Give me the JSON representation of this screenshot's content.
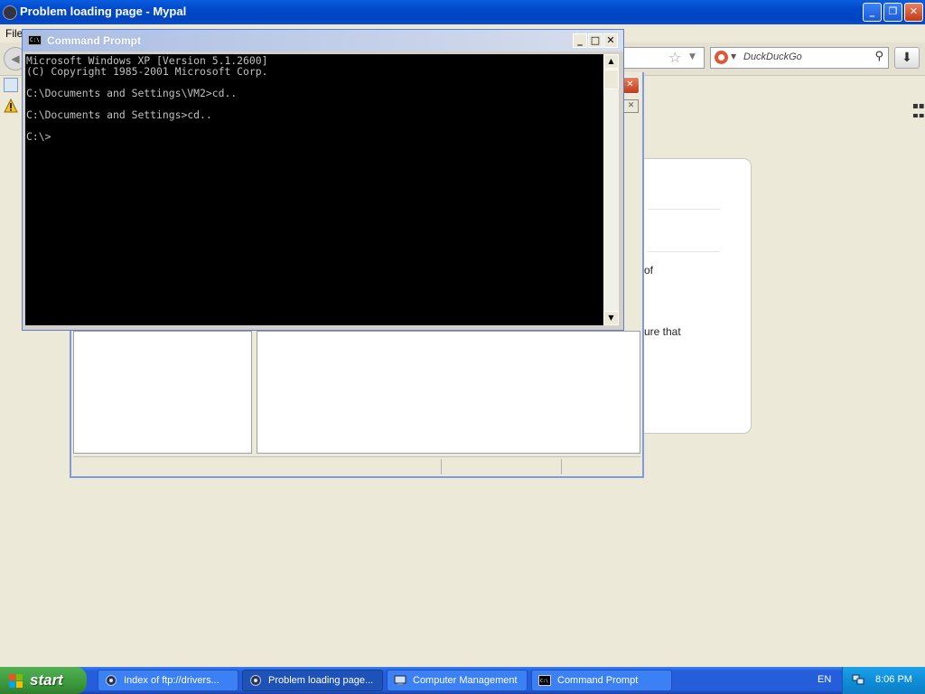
{
  "browser": {
    "title": "Problem loading page - Mypal",
    "menu_first": "File",
    "search_placeholder": "DuckDuckGo",
    "partial_text_1": "of",
    "partial_text_2": "ure that"
  },
  "cmd": {
    "title": "Command Prompt",
    "lines": [
      "Microsoft Windows XP [Version 5.1.2600]",
      "(C) Copyright 1985-2001 Microsoft Corp.",
      "",
      "C:\\Documents and Settings\\VM2>cd..",
      "",
      "C:\\Documents and Settings>cd..",
      "",
      "C:\\>"
    ]
  },
  "taskbar": {
    "start_label": "start",
    "buttons": [
      {
        "label": "Index of ftp://drivers...",
        "icon": "browser-icon"
      },
      {
        "label": "Problem loading page...",
        "icon": "browser-icon"
      },
      {
        "label": "Computer Management",
        "icon": "computer-management-icon"
      },
      {
        "label": "Command Prompt",
        "icon": "cmd-icon"
      }
    ],
    "language": "EN",
    "clock": "8:06 PM"
  },
  "colors": {
    "xp_blue": "#245edb",
    "start_green": "#3c9a3c",
    "console_bg": "#000000",
    "console_text": "#c0c0c0"
  }
}
